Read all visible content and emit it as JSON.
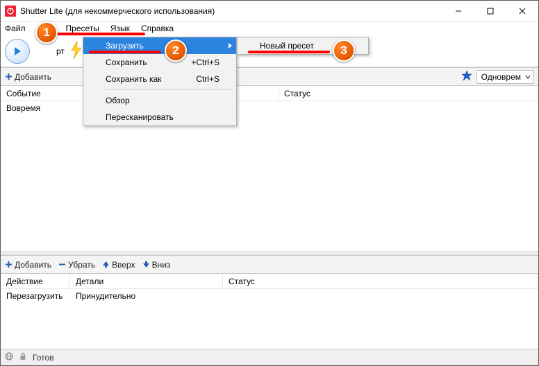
{
  "window": {
    "title": "Shutter Lite (для некоммерческого использования)"
  },
  "menubar": {
    "file_cut": "Файл",
    "presets": "Пресеты",
    "lang": "Язык",
    "help": "Справка"
  },
  "presets_menu": {
    "load": "Загрузить",
    "save": "Сохранить",
    "save_shortcut": "+Ctrl+S",
    "save_as": "Сохранить как",
    "save_as_shortcut": "Ctrl+S",
    "browse": "Обзор",
    "rescan": "Пересканировать"
  },
  "submenu": {
    "new_preset": "Новый пресет"
  },
  "toolbar": {
    "start": "рт"
  },
  "top_section": {
    "add": "Добавить",
    "mode_label": "Одноврем",
    "col_event": "Событие",
    "col_status": "Статус",
    "row_time": "Вовремя"
  },
  "bottom_section": {
    "add": "Добавить",
    "remove": "Убрать",
    "up": "Вверх",
    "down": "Вниз",
    "col_action": "Действие",
    "col_details": "Детали",
    "col_status": "Статус",
    "row_action": "Перезагрузить",
    "row_details": "Принудительно"
  },
  "status": {
    "ready": "Готов"
  },
  "badges": {
    "b1": "1",
    "b2": "2",
    "b3": "3"
  }
}
